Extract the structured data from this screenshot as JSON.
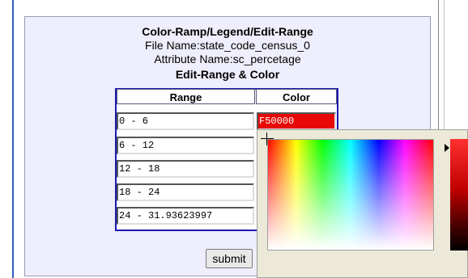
{
  "header": {
    "title": "Color-Ramp/Legend/Edit-Range",
    "file_name": "File Name:state_code_census_0",
    "attribute_name": "Attribute Name:sc_percetage",
    "subtitle": "Edit-Range & Color"
  },
  "table": {
    "col_range": "Range",
    "col_color": "Color",
    "rows": [
      {
        "range": "0 - 6"
      },
      {
        "range": "6 - 12"
      },
      {
        "range": "12 - 18"
      },
      {
        "range": "18 - 24"
      },
      {
        "range": "24 - 31.93623997"
      }
    ],
    "first_color_value": "F50000"
  },
  "submit_label": "submit",
  "colors": {
    "panel_bg": "#eeeefc",
    "table_border": "#1a1ab0",
    "selected_color": "#e80808"
  },
  "icons": {
    "crosshair": "crosshair-icon",
    "arrow": "triangle-right-icon"
  }
}
